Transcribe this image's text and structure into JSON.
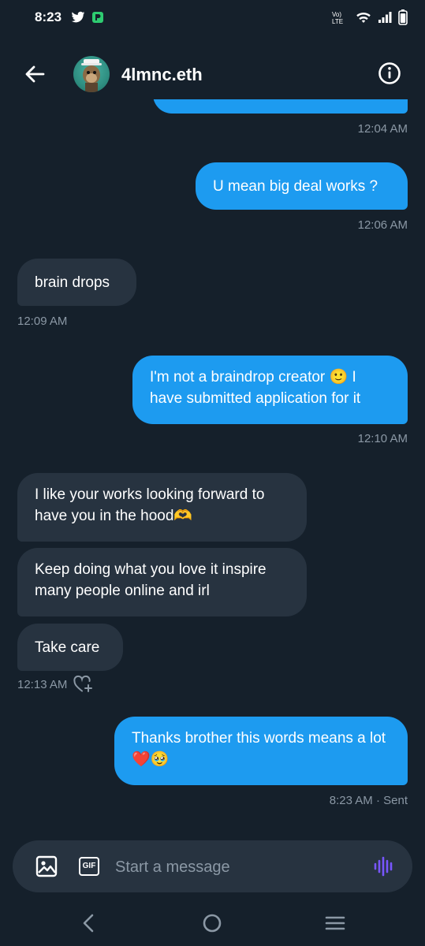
{
  "status_bar": {
    "time": "8:23",
    "network": "LTE"
  },
  "header": {
    "contact_name": "4lmnc.eth"
  },
  "messages": [
    {
      "dir": "out",
      "text": "",
      "time": "12:04 AM"
    },
    {
      "dir": "out",
      "text": "U mean big deal works ?",
      "time": "12:06 AM"
    },
    {
      "dir": "in",
      "text": "brain drops",
      "time": "12:09 AM"
    },
    {
      "dir": "out",
      "text": "I'm not a braindrop creator 🙂 I have submitted application for it",
      "time": "12:10 AM"
    },
    {
      "dir": "in",
      "text": "I like your works looking forward to have you in the hood🫶"
    },
    {
      "dir": "in",
      "text": "Keep doing what you love it inspire many people online and irl"
    },
    {
      "dir": "in",
      "text": "Take care",
      "time": "12:13 AM"
    },
    {
      "dir": "out",
      "text": "Thanks brother this words means a lot ❤️🥹",
      "time": "8:23 AM · Sent"
    }
  ],
  "composer": {
    "placeholder": "Start a message",
    "gif_label": "GIF"
  },
  "colors": {
    "background": "#15202b",
    "outgoing_bubble": "#1d9bf0",
    "incoming_bubble": "#273340",
    "timestamp": "#8b98a5",
    "voice_accent": "#7856ff"
  }
}
